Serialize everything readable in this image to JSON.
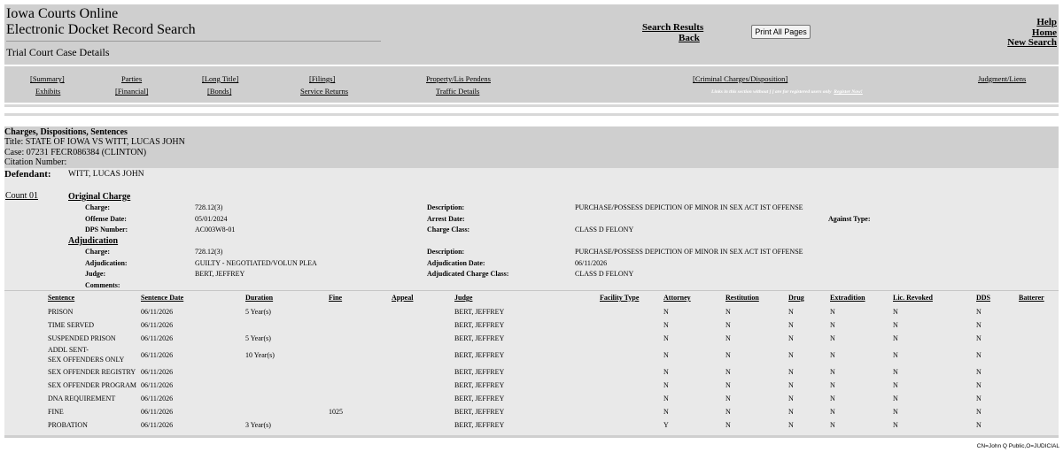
{
  "header": {
    "title_line1": "Iowa Courts Online",
    "title_line2": "Electronic Docket Record Search",
    "subtitle": "Trial Court Case Details",
    "search_results": "Search Results",
    "back": "Back",
    "print_all": "Print All Pages",
    "help": "Help",
    "home": "Home",
    "new_search": "New Search"
  },
  "nav": {
    "summary": "[Summary]",
    "exhibits": "Exhibits",
    "parties": "Parties",
    "financial": "[Financial]",
    "long_title": "[Long Title]",
    "bonds": "[Bonds]",
    "filings": "[Filings]",
    "service_returns": "Service Returns",
    "property": "Property/Lis Pendens",
    "traffic": "Traffic Details",
    "criminal": "[Criminal Charges/Disposition]",
    "judgment": "Judgment/Liens",
    "note": "Links in this section without [ ] are for registered users only",
    "register": "Register Now!"
  },
  "case": {
    "heading": "Charges, Dispositions, Sentences",
    "title": "Title: STATE OF IOWA VS WITT, LUCAS JOHN",
    "case": "Case: 07231 FECR086384 (CLINTON)",
    "citation": "Citation Number:"
  },
  "defendant": {
    "label": "Defendant:",
    "value": "WITT, LUCAS JOHN"
  },
  "count": {
    "label": "Count 01",
    "original_heading": "Original Charge",
    "original": {
      "charge_label": "Charge:",
      "charge": "728.12(3)",
      "offense_date_label": "Offense Date:",
      "offense_date": "05/01/2024",
      "dps_label": "DPS Number:",
      "dps": "AC003W8-01",
      "desc_label": "Description:",
      "desc": "PURCHASE/POSSESS DEPICTION OF MINOR IN SEX ACT IST OFFENSE",
      "arrest_label": "Arrest Date:",
      "class_label": "Charge Class:",
      "class": "CLASS D FELONY",
      "against_label": "Against Type:"
    },
    "adjudication_heading": "Adjudication",
    "adjudication": {
      "charge_label": "Charge:",
      "charge": "728.12(3)",
      "adj_label": "Adjudication:",
      "adj": "GUILTY - NEGOTIATED/VOLUN PLEA",
      "judge_label": "Judge:",
      "judge": "BERT, JEFFREY",
      "comments_label": "Comments:",
      "desc_label": "Description:",
      "desc": "PURCHASE/POSSESS DEPICTION OF MINOR IN SEX ACT IST OFFENSE",
      "adj_date_label": "Adjudication Date:",
      "adj_date": "06/11/2026",
      "adj_class_label": "Adjudicated Charge Class:",
      "adj_class": "CLASS D FELONY"
    }
  },
  "sentences": {
    "headers": [
      "Sentence",
      "Sentence Date",
      "Duration",
      "Fine",
      "Appeal",
      "Judge",
      "Facility Type",
      "Attorney",
      "Restitution",
      "Drug",
      "Extradition",
      "Lic. Revoked",
      "DDS",
      "Batterer"
    ],
    "rows": [
      {
        "sentence": "PRISON",
        "sentence2": "",
        "date": "06/11/2026",
        "duration": "5 Year(s)",
        "fine": "",
        "judge": "BERT, JEFFREY",
        "attorney": "N",
        "restitution": "N",
        "drug": "N",
        "extradition": "N",
        "lic": "N",
        "dds": "N"
      },
      {
        "sentence": "TIME SERVED",
        "sentence2": "",
        "date": "06/11/2026",
        "duration": "",
        "fine": "",
        "judge": "BERT, JEFFREY",
        "attorney": "N",
        "restitution": "N",
        "drug": "N",
        "extradition": "N",
        "lic": "N",
        "dds": "N"
      },
      {
        "sentence": "SUSPENDED PRISON",
        "sentence2": "",
        "date": "06/11/2026",
        "duration": "5 Year(s)",
        "fine": "",
        "judge": "BERT, JEFFREY",
        "attorney": "N",
        "restitution": "N",
        "drug": "N",
        "extradition": "N",
        "lic": "N",
        "dds": "N"
      },
      {
        "sentence": "ADDL SENT-",
        "sentence2": "SEX OFFENDERS ONLY",
        "date": "06/11/2026",
        "duration": "10 Year(s)",
        "fine": "",
        "judge": "BERT, JEFFREY",
        "attorney": "N",
        "restitution": "N",
        "drug": "N",
        "extradition": "N",
        "lic": "N",
        "dds": "N"
      },
      {
        "sentence": "SEX OFFENDER REGISTRY",
        "sentence2": "",
        "date": "06/11/2026",
        "duration": "",
        "fine": "",
        "judge": "BERT, JEFFREY",
        "attorney": "N",
        "restitution": "N",
        "drug": "N",
        "extradition": "N",
        "lic": "N",
        "dds": "N"
      },
      {
        "sentence": "SEX OFFENDER PROGRAM",
        "sentence2": "",
        "date": "06/11/2026",
        "duration": "",
        "fine": "",
        "judge": "BERT, JEFFREY",
        "attorney": "N",
        "restitution": "N",
        "drug": "N",
        "extradition": "N",
        "lic": "N",
        "dds": "N"
      },
      {
        "sentence": "DNA REQUIREMENT",
        "sentence2": "",
        "date": "06/11/2026",
        "duration": "",
        "fine": "",
        "judge": "BERT, JEFFREY",
        "attorney": "N",
        "restitution": "N",
        "drug": "N",
        "extradition": "N",
        "lic": "N",
        "dds": "N"
      },
      {
        "sentence": "FINE",
        "sentence2": "",
        "date": "06/11/2026",
        "duration": "",
        "fine": "1025",
        "judge": "BERT, JEFFREY",
        "attorney": "N",
        "restitution": "N",
        "drug": "N",
        "extradition": "N",
        "lic": "N",
        "dds": "N"
      },
      {
        "sentence": "PROBATION",
        "sentence2": "",
        "date": "06/11/2026",
        "duration": "3 Year(s)",
        "fine": "",
        "judge": "BERT, JEFFREY",
        "attorney": "Y",
        "restitution": "N",
        "drug": "N",
        "extradition": "N",
        "lic": "N",
        "dds": "N"
      }
    ]
  },
  "footer": {
    "cert": "CN=John Q Public,O=JUDICIAL"
  }
}
